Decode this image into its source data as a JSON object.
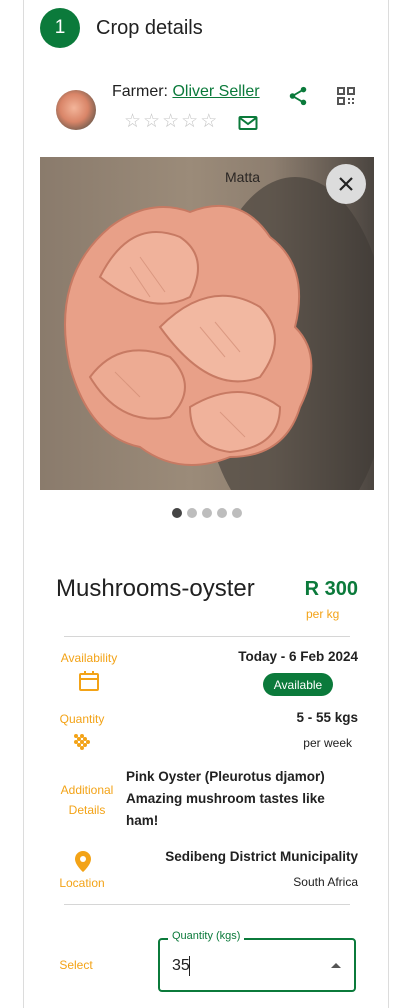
{
  "step": {
    "number": "1",
    "title": "Crop details"
  },
  "farmer": {
    "label": "Farmer:",
    "name": "Oliver Seller",
    "rating_stars": 5,
    "rating_value": 0
  },
  "icons": {
    "share": "share-icon",
    "qr": "qr-code-icon",
    "mail": "mail-icon",
    "close": "close-icon",
    "calendar": "calendar-icon",
    "quantity": "grain-icon",
    "location": "location-pin-icon"
  },
  "carousel": {
    "total_slides": 5,
    "active_slide": 1
  },
  "crop": {
    "name": "Mushrooms-oyster",
    "price": "R 300",
    "price_unit": "per kg"
  },
  "availability": {
    "label": "Availability",
    "dates": "Today - 6 Feb 2024",
    "status": "Available"
  },
  "quantity": {
    "label": "Quantity",
    "range": "5 - 55 kgs",
    "period": "per week"
  },
  "additional": {
    "label_line1": "Additional",
    "label_line2": "Details",
    "text": "Pink Oyster (Pleurotus djamor) Amazing mushroom tastes like ham!"
  },
  "location": {
    "label": "Location",
    "municipality": "Sedibeng District Municipality",
    "country": "South Africa"
  },
  "select": {
    "label": "Select",
    "field_label": "Quantity (kgs)",
    "value": "35"
  },
  "colors": {
    "primary": "#0b7a3b",
    "accent": "#f3a317",
    "text": "#212121"
  }
}
